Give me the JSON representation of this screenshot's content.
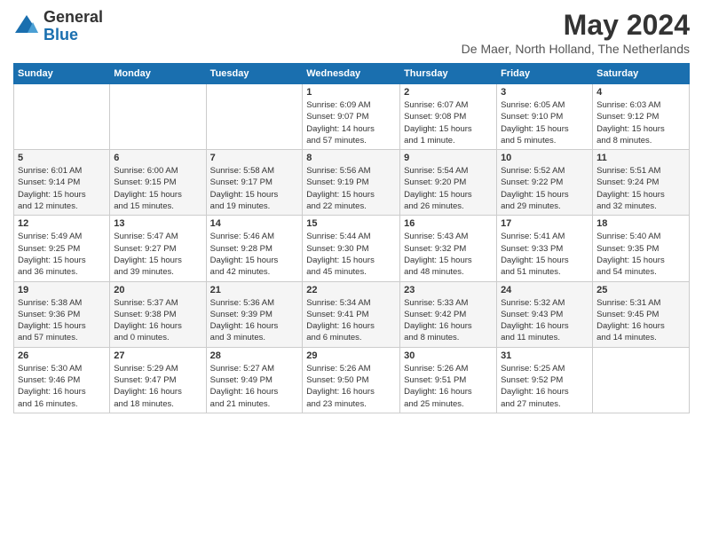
{
  "logo": {
    "general": "General",
    "blue": "Blue"
  },
  "header": {
    "month": "May 2024",
    "location": "De Maer, North Holland, The Netherlands"
  },
  "days_of_week": [
    "Sunday",
    "Monday",
    "Tuesday",
    "Wednesday",
    "Thursday",
    "Friday",
    "Saturday"
  ],
  "weeks": [
    [
      {
        "day": "",
        "info": ""
      },
      {
        "day": "",
        "info": ""
      },
      {
        "day": "",
        "info": ""
      },
      {
        "day": "1",
        "info": "Sunrise: 6:09 AM\nSunset: 9:07 PM\nDaylight: 14 hours\nand 57 minutes."
      },
      {
        "day": "2",
        "info": "Sunrise: 6:07 AM\nSunset: 9:08 PM\nDaylight: 15 hours\nand 1 minute."
      },
      {
        "day": "3",
        "info": "Sunrise: 6:05 AM\nSunset: 9:10 PM\nDaylight: 15 hours\nand 5 minutes."
      },
      {
        "day": "4",
        "info": "Sunrise: 6:03 AM\nSunset: 9:12 PM\nDaylight: 15 hours\nand 8 minutes."
      }
    ],
    [
      {
        "day": "5",
        "info": "Sunrise: 6:01 AM\nSunset: 9:14 PM\nDaylight: 15 hours\nand 12 minutes."
      },
      {
        "day": "6",
        "info": "Sunrise: 6:00 AM\nSunset: 9:15 PM\nDaylight: 15 hours\nand 15 minutes."
      },
      {
        "day": "7",
        "info": "Sunrise: 5:58 AM\nSunset: 9:17 PM\nDaylight: 15 hours\nand 19 minutes."
      },
      {
        "day": "8",
        "info": "Sunrise: 5:56 AM\nSunset: 9:19 PM\nDaylight: 15 hours\nand 22 minutes."
      },
      {
        "day": "9",
        "info": "Sunrise: 5:54 AM\nSunset: 9:20 PM\nDaylight: 15 hours\nand 26 minutes."
      },
      {
        "day": "10",
        "info": "Sunrise: 5:52 AM\nSunset: 9:22 PM\nDaylight: 15 hours\nand 29 minutes."
      },
      {
        "day": "11",
        "info": "Sunrise: 5:51 AM\nSunset: 9:24 PM\nDaylight: 15 hours\nand 32 minutes."
      }
    ],
    [
      {
        "day": "12",
        "info": "Sunrise: 5:49 AM\nSunset: 9:25 PM\nDaylight: 15 hours\nand 36 minutes."
      },
      {
        "day": "13",
        "info": "Sunrise: 5:47 AM\nSunset: 9:27 PM\nDaylight: 15 hours\nand 39 minutes."
      },
      {
        "day": "14",
        "info": "Sunrise: 5:46 AM\nSunset: 9:28 PM\nDaylight: 15 hours\nand 42 minutes."
      },
      {
        "day": "15",
        "info": "Sunrise: 5:44 AM\nSunset: 9:30 PM\nDaylight: 15 hours\nand 45 minutes."
      },
      {
        "day": "16",
        "info": "Sunrise: 5:43 AM\nSunset: 9:32 PM\nDaylight: 15 hours\nand 48 minutes."
      },
      {
        "day": "17",
        "info": "Sunrise: 5:41 AM\nSunset: 9:33 PM\nDaylight: 15 hours\nand 51 minutes."
      },
      {
        "day": "18",
        "info": "Sunrise: 5:40 AM\nSunset: 9:35 PM\nDaylight: 15 hours\nand 54 minutes."
      }
    ],
    [
      {
        "day": "19",
        "info": "Sunrise: 5:38 AM\nSunset: 9:36 PM\nDaylight: 15 hours\nand 57 minutes."
      },
      {
        "day": "20",
        "info": "Sunrise: 5:37 AM\nSunset: 9:38 PM\nDaylight: 16 hours\nand 0 minutes."
      },
      {
        "day": "21",
        "info": "Sunrise: 5:36 AM\nSunset: 9:39 PM\nDaylight: 16 hours\nand 3 minutes."
      },
      {
        "day": "22",
        "info": "Sunrise: 5:34 AM\nSunset: 9:41 PM\nDaylight: 16 hours\nand 6 minutes."
      },
      {
        "day": "23",
        "info": "Sunrise: 5:33 AM\nSunset: 9:42 PM\nDaylight: 16 hours\nand 8 minutes."
      },
      {
        "day": "24",
        "info": "Sunrise: 5:32 AM\nSunset: 9:43 PM\nDaylight: 16 hours\nand 11 minutes."
      },
      {
        "day": "25",
        "info": "Sunrise: 5:31 AM\nSunset: 9:45 PM\nDaylight: 16 hours\nand 14 minutes."
      }
    ],
    [
      {
        "day": "26",
        "info": "Sunrise: 5:30 AM\nSunset: 9:46 PM\nDaylight: 16 hours\nand 16 minutes."
      },
      {
        "day": "27",
        "info": "Sunrise: 5:29 AM\nSunset: 9:47 PM\nDaylight: 16 hours\nand 18 minutes."
      },
      {
        "day": "28",
        "info": "Sunrise: 5:27 AM\nSunset: 9:49 PM\nDaylight: 16 hours\nand 21 minutes."
      },
      {
        "day": "29",
        "info": "Sunrise: 5:26 AM\nSunset: 9:50 PM\nDaylight: 16 hours\nand 23 minutes."
      },
      {
        "day": "30",
        "info": "Sunrise: 5:26 AM\nSunset: 9:51 PM\nDaylight: 16 hours\nand 25 minutes."
      },
      {
        "day": "31",
        "info": "Sunrise: 5:25 AM\nSunset: 9:52 PM\nDaylight: 16 hours\nand 27 minutes."
      },
      {
        "day": "",
        "info": ""
      }
    ]
  ]
}
